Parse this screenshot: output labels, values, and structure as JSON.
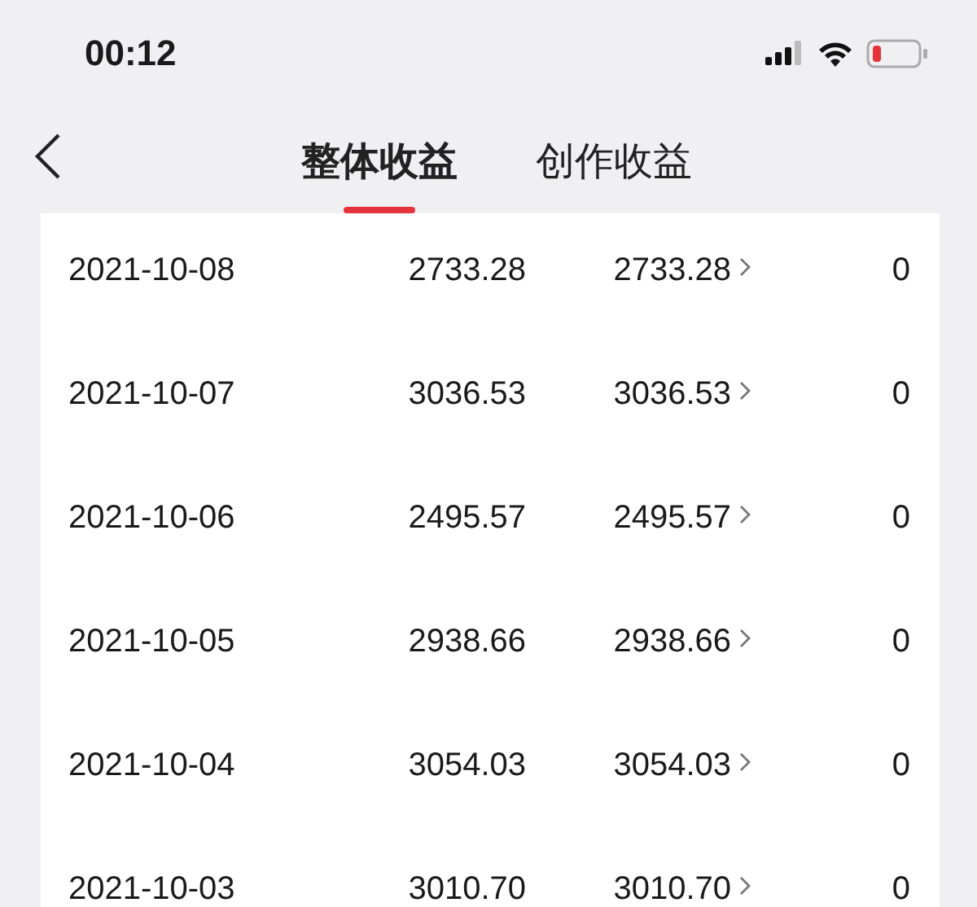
{
  "status_bar": {
    "time": "00:12"
  },
  "tabs": [
    {
      "label": "整体收益",
      "selected": true
    },
    {
      "label": "创作收益",
      "selected": false
    }
  ],
  "rows": [
    {
      "date": "2021-10-08",
      "total": "2733.28",
      "creation": "2733.28",
      "column_4": "0"
    },
    {
      "date": "2021-10-07",
      "total": "3036.53",
      "creation": "3036.53",
      "column_4": "0"
    },
    {
      "date": "2021-10-06",
      "total": "2495.57",
      "creation": "2495.57",
      "column_4": "0"
    },
    {
      "date": "2021-10-05",
      "total": "2938.66",
      "creation": "2938.66",
      "column_4": "0"
    },
    {
      "date": "2021-10-04",
      "total": "3054.03",
      "creation": "3054.03",
      "column_4": "0"
    },
    {
      "date": "2021-10-03",
      "total": "3010.70",
      "creation": "3010.70",
      "column_4": "0"
    }
  ]
}
